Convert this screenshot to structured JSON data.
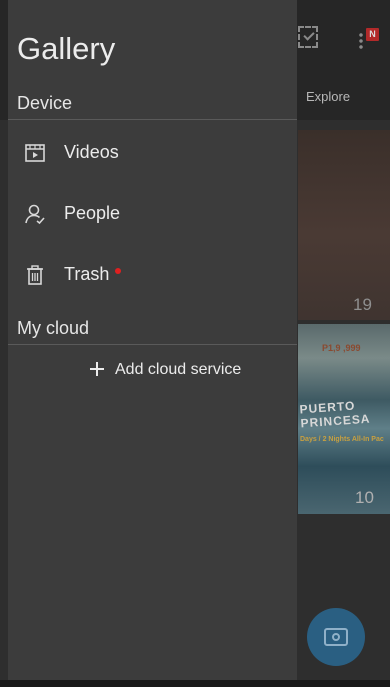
{
  "drawer": {
    "title": "Gallery",
    "device_section": "Device",
    "items": [
      {
        "label": "Videos",
        "icon": "video-icon"
      },
      {
        "label": "People",
        "icon": "people-icon"
      },
      {
        "label": "Trash",
        "icon": "trash-icon",
        "has_notification_dot": true
      }
    ],
    "cloud_section": "My cloud",
    "add_cloud_label": "Add cloud service"
  },
  "background": {
    "tab_explore": "Explore",
    "album_counts": [
      "19",
      "10"
    ],
    "notification_badge": "N",
    "album_text": {
      "price": "P1,9 ,999",
      "title_line1": "PUERTO",
      "title_line2": "PRINCESA",
      "subtitle": "Days / 2 Nights All-In Pac"
    }
  },
  "colors": {
    "drawer_bg": "#3c3c3c",
    "notification_dot": "#e02020",
    "fab": "#2a5f82"
  }
}
